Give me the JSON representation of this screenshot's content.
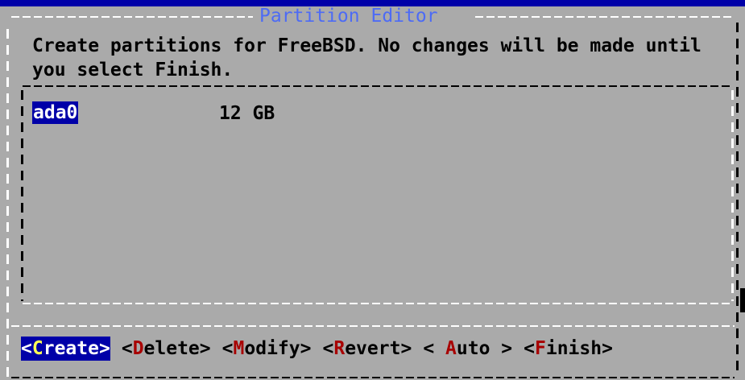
{
  "dialog": {
    "title": "Partition Editor",
    "prompt": "Create partitions for FreeBSD. No changes will be made until you select Finish."
  },
  "disks": [
    {
      "name": "ada0",
      "size": "12 GB",
      "selected": true
    }
  ],
  "buttons": [
    {
      "open": "<",
      "hot": "C",
      "rest": "reate",
      "close": ">",
      "focused": true
    },
    {
      "open": "<",
      "hot": "D",
      "rest": "elete",
      "close": ">",
      "focused": false
    },
    {
      "open": "<",
      "hot": "M",
      "rest": "odify",
      "close": ">",
      "focused": false
    },
    {
      "open": "<",
      "hot": "R",
      "rest": "evert",
      "close": ">",
      "focused": false
    },
    {
      "open": "< ",
      "hot": "A",
      "rest": "uto",
      "close": " >",
      "focused": false
    },
    {
      "open": "<",
      "hot": "F",
      "rest": "inish",
      "close": ">",
      "focused": false
    }
  ],
  "colors": {
    "screen_background": "#0000a8",
    "dialog_background": "#aaaaaa",
    "title_text": "#4d6bf5",
    "selection_background": "#0000a8",
    "selection_text": "#ffffff",
    "hotkey": "#a80000",
    "focused_hotkey": "#ffff55"
  }
}
